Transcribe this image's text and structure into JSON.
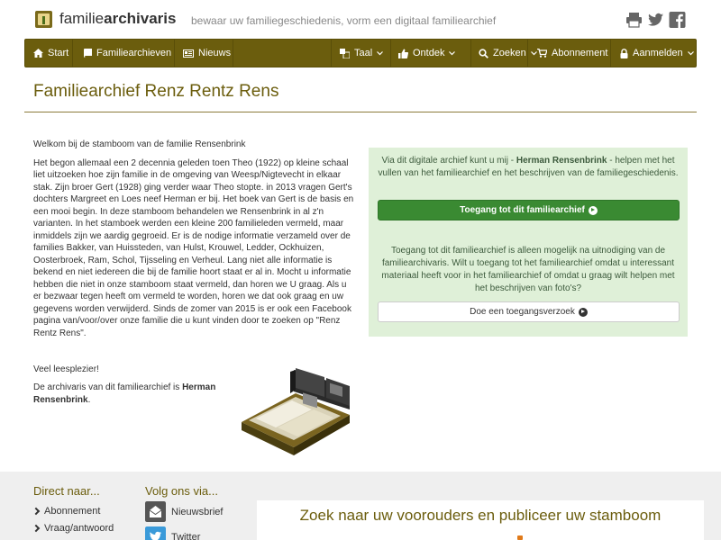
{
  "header": {
    "brand_plain": "familie",
    "brand_bold": "archivaris",
    "tagline": "bewaar uw familiegeschiedenis, vorm een digitaal familiearchief"
  },
  "nav": {
    "items": [
      {
        "label": "Start",
        "icon": "home-icon"
      },
      {
        "label": "Familiearchieven",
        "icon": "book-icon"
      },
      {
        "label": "Nieuws",
        "icon": "newspaper-icon"
      },
      {
        "label": "Taal",
        "icon": "language-icon"
      },
      {
        "label": "Ontdek",
        "icon": "thumbs-up-icon"
      },
      {
        "label": "Zoeken",
        "icon": "search-icon"
      },
      {
        "label": "Abonnement",
        "icon": "cart-icon"
      },
      {
        "label": "Aanmelden",
        "icon": "lock-icon"
      }
    ],
    "bg_color": "#6b5d0d"
  },
  "page": {
    "title": "Familiearchief Renz Rentz Rens"
  },
  "intro": {
    "welcome": "Welkom bij de stamboom van de familie Rensenbrink",
    "body": "Het begon allemaal een 2 decennia geleden toen Theo (1922) op kleine schaal liet uitzoeken hoe zijn familie in de omgeving van Weesp/Nigtevecht in elkaar stak. Zijn broer Gert (1928) ging verder waar Theo stopte. in 2013 vragen Gert's dochters Margreet en Loes neef Herman er bij. Het boek van Gert is de basis en een mooi begin. In deze stamboom behandelen we Rensenbrink in al z'n varianten. In het stamboek werden een kleine 200 familieleden vermeld, maar inmiddels zijn we aardig gegroeid. Er is de nodige informatie verzameld over de families Bakker, van Huissteden, van Hulst, Krouwel, Ledder, Ockhuizen, Oosterbroek, Ram, Schol, Tijsseling en Verheul. Lang niet alle informatie is bekend en niet iedereen die bij de familie hoort staat er al in. Mocht u informatie hebben die niet in onze stamboom staat vermeld, dan horen we U graag. Als u er bezwaar tegen heeft om vermeld te worden, horen we dat ook graag en uw gegevens worden verwijderd. Sinds de zomer van 2015 is er ook een Facebook pagina van/voor/over onze familie die u kunt vinden door te zoeken op \"Renz Rentz Rens\".",
    "closing": "Veel leesplezier!",
    "archivist_prefix": "De archivaris van dit familiearchief is ",
    "archivist_name": "Herman Rensenbrink",
    "archivist_suffix": "."
  },
  "panel": {
    "text1_prefix": "Via dit digitale archief kunt u mij - ",
    "text1_name": "Herman Rensenbrink",
    "text1_suffix": " - helpen met het vullen van het familiearchief en het beschrijven van de familiegeschiedenis.",
    "access_button": "Toegang tot dit familiearchief",
    "text2": "Toegang tot dit familiearchief is alleen mogelijk na uitnodiging van de familiearchivaris. Wilt u toegang tot het familiearchief omdat u interessant materiaal heeft voor in het familiearchief of omdat u graag wilt helpen met het beschrijven van foto's?",
    "request_button": "Doe een toegangsverzoek",
    "bg_color": "#dff0d8",
    "button_color": "#3a8a32"
  },
  "footer": {
    "direct_heading": "Direct naar...",
    "direct_links": [
      "Abonnement",
      "Vraag/antwoord"
    ],
    "follow_heading": "Volg ons via...",
    "follow_links": [
      {
        "label": "Nieuwsbrief",
        "icon": "newsletter-icon"
      },
      {
        "label": "Twitter",
        "icon": "twitter-icon"
      }
    ],
    "search_title": "Zoek naar uw voorouders en publiceer uw stamboom"
  }
}
